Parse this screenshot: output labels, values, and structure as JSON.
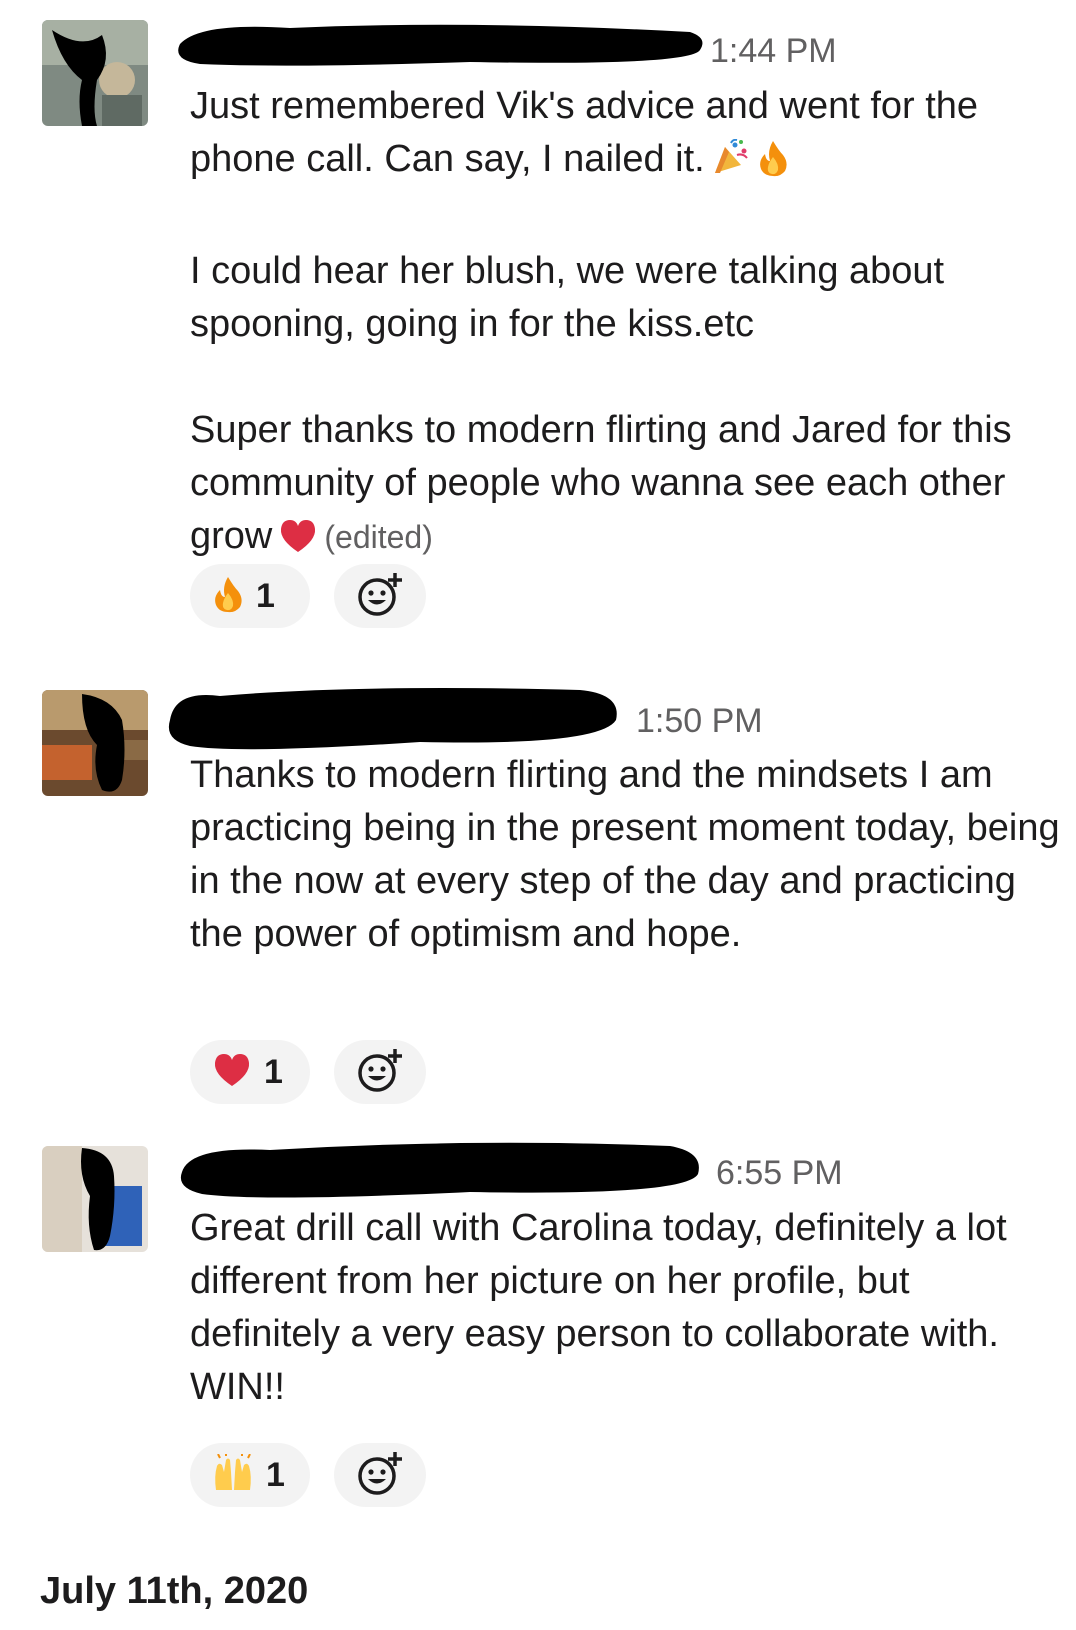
{
  "messages": [
    {
      "time": "1:44 PM",
      "paragraphs": [
        "Just remembered Vik's advice and went for the phone call. Can say, I nailed it.",
        "I could hear her blush, we were talking about spooning, going in for the kiss.etc",
        "Super thanks to modern flirting and Jared for this community of people who wanna see each other grow"
      ],
      "edited_label": "(edited)",
      "reaction": {
        "icon": "fire-icon",
        "count": "1"
      }
    },
    {
      "time": "1:50 PM",
      "paragraphs": [
        "Thanks to modern flirting and the mindsets I am practicing being in the present moment today, being in the now at every step of the day and practicing the power of optimism and hope."
      ],
      "reaction": {
        "icon": "heart-icon",
        "count": "1"
      }
    },
    {
      "time": "6:55 PM",
      "paragraphs": [
        "Great drill call with Carolina today, definitely a lot different from her picture on her profile, but definitely a very easy person to collaborate with. WIN!!"
      ],
      "reaction": {
        "icon": "raised-hands-icon",
        "count": "1"
      }
    }
  ],
  "date_divider": "July 11th, 2020",
  "colors": {
    "text": "#1d1c1d",
    "muted": "#616061",
    "reaction_bg": "#f3f3f3",
    "redaction": "#000000"
  }
}
